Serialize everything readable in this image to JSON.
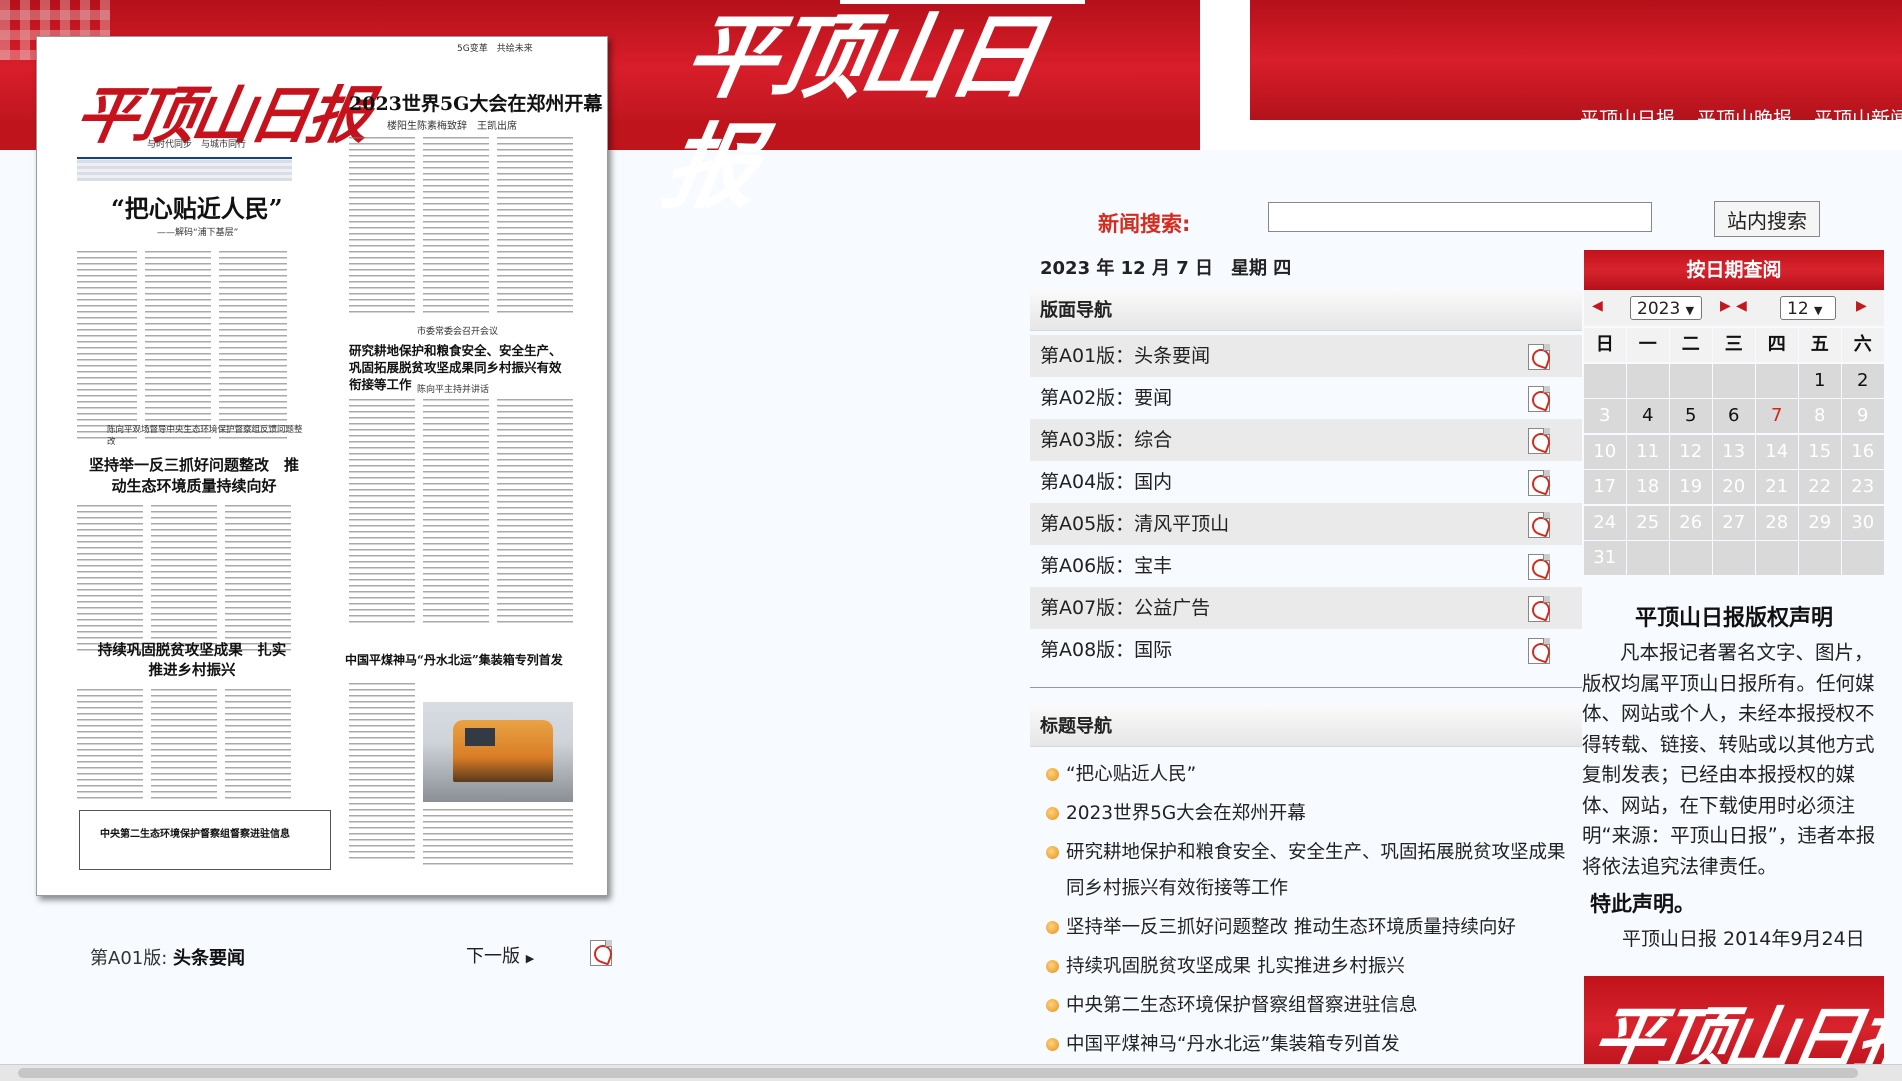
{
  "banner": {
    "logo_text": "平顶山日报",
    "links": [
      "平顶山日报",
      "平顶山晚报",
      "平顶山新闻网"
    ]
  },
  "paper": {
    "masthead": "平顶山日报",
    "slogan": "与时代同步　与城市同行",
    "headline_main": "2023世界5G大会在郑州开幕",
    "headline_main_kicker": "5G变革　共绘未来",
    "headline_main_sub": "楼阳生陈素梅致辞　王凯出席",
    "headline_left": "“把心贴近人民”",
    "headline_left_sub": "——解码“浦下基层”",
    "headline_mid": "研究耕地保护和粮食安全、安全生产、巩固拓展脱贫攻坚成果同乡村振兴有效衔接等工作",
    "headline_mid_kicker": "市委常委会召开会议",
    "headline_mid_sub": "陈向平主持并讲话",
    "headline_env_kicker": "陈向平观场督导中央生态环境保护督察组反馈问题整改",
    "headline_env": "坚持举一反三抓好问题整改　推动生态环境质量持续向好",
    "headline_rural": "持续巩固脱贫攻坚成果　扎实推进乡村振兴",
    "headline_coal": "中国平煤神马“丹水北运”集装箱专列首发",
    "box_title": "中央第二生态环境保护督察组督察进驻信息"
  },
  "caption": {
    "page_prefix": "第A01版:",
    "page_name": "头条要闻",
    "next_label": "下一版"
  },
  "search": {
    "label": "新闻搜索:",
    "placeholder": "",
    "button": "站内搜索"
  },
  "date_line": "2023 年 12 月 7 日　星期 四",
  "page_nav": {
    "header": "版面导航",
    "items": [
      "第A01版：头条要闻",
      "第A02版：要闻",
      "第A03版：综合",
      "第A04版：国内",
      "第A05版：清风平顶山",
      "第A06版：宝丰",
      "第A07版：公益广告",
      "第A08版：国际"
    ]
  },
  "title_nav": {
    "header": "标题导航",
    "items": [
      "“把心贴近人民”",
      "2023世界5G大会在郑州开幕",
      "研究耕地保护和粮食安全、安全生产、巩固拓展脱贫攻坚成果同乡村振兴有效衔接等工作",
      "坚持举一反三抓好问题整改 推动生态环境质量持续向好",
      "持续巩固脱贫攻坚成果 扎实推进乡村振兴",
      "中央第二生态环境保护督察组督察进驻信息",
      "中国平煤神马“丹水北运”集装箱专列首发"
    ]
  },
  "calendar": {
    "header": "按日期查阅",
    "year": "2023",
    "month": "12",
    "weekdays": [
      "日",
      "一",
      "二",
      "三",
      "四",
      "五",
      "六"
    ],
    "days": [
      "",
      "",
      "",
      "",
      "",
      "1",
      "2",
      "3",
      "4",
      "5",
      "6",
      "7",
      "8",
      "9",
      "10",
      "11",
      "12",
      "13",
      "14",
      "15",
      "16",
      "17",
      "18",
      "19",
      "20",
      "21",
      "22",
      "23",
      "24",
      "25",
      "26",
      "27",
      "28",
      "29",
      "30",
      "31",
      "",
      "",
      "",
      "",
      "",
      ""
    ],
    "active_days": [
      "1",
      "2",
      "4",
      "5",
      "6"
    ],
    "selected_day": "7"
  },
  "copyright": {
    "title": "平顶山日报版权声明",
    "body": "凡本报记者署名文字、图片，版权均属平顶山日报所有。任何媒体、网站或个人，未经本报授权不得转载、链接、转贴或以其他方式复制发表；已经由本报授权的媒体、网站，在下载使用时必须注明“来源：平顶山日报”，违者本报将依法追究法律责任。",
    "note": "特此声明。",
    "signature": "平顶山日报 2014年9月24日"
  },
  "footer_logo": "平顶山日报",
  "colors": {
    "brand_red": "#c5121c",
    "search_label": "#d42d1f",
    "calendar_today": "#d4251c"
  }
}
